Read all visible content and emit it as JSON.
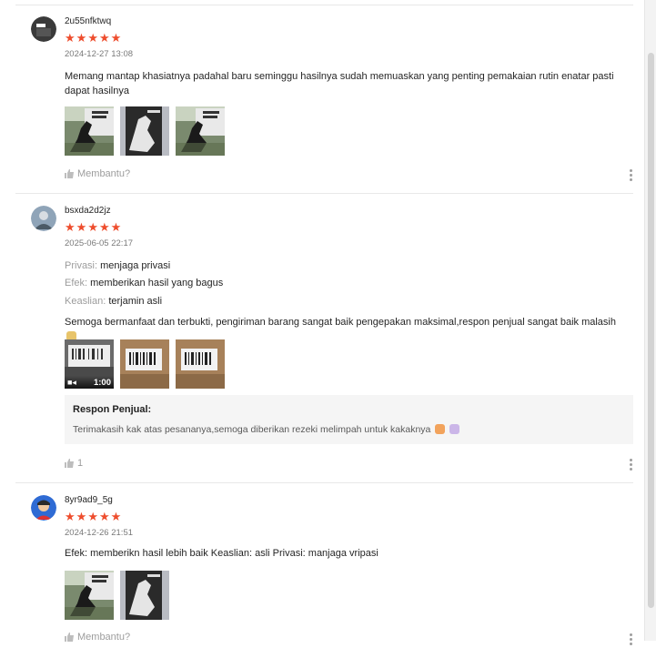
{
  "colors": {
    "star": "#ee4d2d",
    "text_primary": "#212121",
    "text_muted": "#9e9e9e"
  },
  "reviews": [
    {
      "username": "2u55nfktwq",
      "rating": 5,
      "datetime": "2024-12-27 13:08",
      "comment": "Memang mantap khasiatnya padahal baru seminggu hasilnya sudah memuaskan yang penting pemakaian rutin enatar pasti dapat hasilnya",
      "media_count": 3,
      "helpful_label": "Membantu?"
    },
    {
      "username": "bsxda2d2jz",
      "rating": 5,
      "datetime": "2025-06-05 22:17",
      "attributes": [
        {
          "key": "Privasi:",
          "value": "menjaga privasi"
        },
        {
          "key": "Efek:",
          "value": "memberikan hasil yang bagus"
        },
        {
          "key": "Keaslian:",
          "value": "terjamin asli"
        }
      ],
      "comment": "Semoga bermanfaat dan terbukti, pengiriman barang sangat baik pengepakan maksimal,respon penjual sangat baik malasih",
      "video_duration": "1:00",
      "seller_reply": {
        "title": "Respon Penjual:",
        "text": "Terimakasih kak atas pesananya,semoga diberikan rezeki melimpah untuk kakaknya"
      },
      "helpful_count": "1"
    },
    {
      "username": "8yr9ad9_5g",
      "rating": 5,
      "datetime": "2024-12-26 21:51",
      "comment": "Efek: memberikn hasil lebih baik Keaslian: asli Privasi: manjaga vripasi",
      "media_count": 2,
      "helpful_label": "Membantu?"
    }
  ],
  "icons": {
    "star": "star-icon",
    "thumbs_up": "thumbs-up-icon",
    "more": "more-vertical-icon",
    "video": "video-camera-icon"
  }
}
